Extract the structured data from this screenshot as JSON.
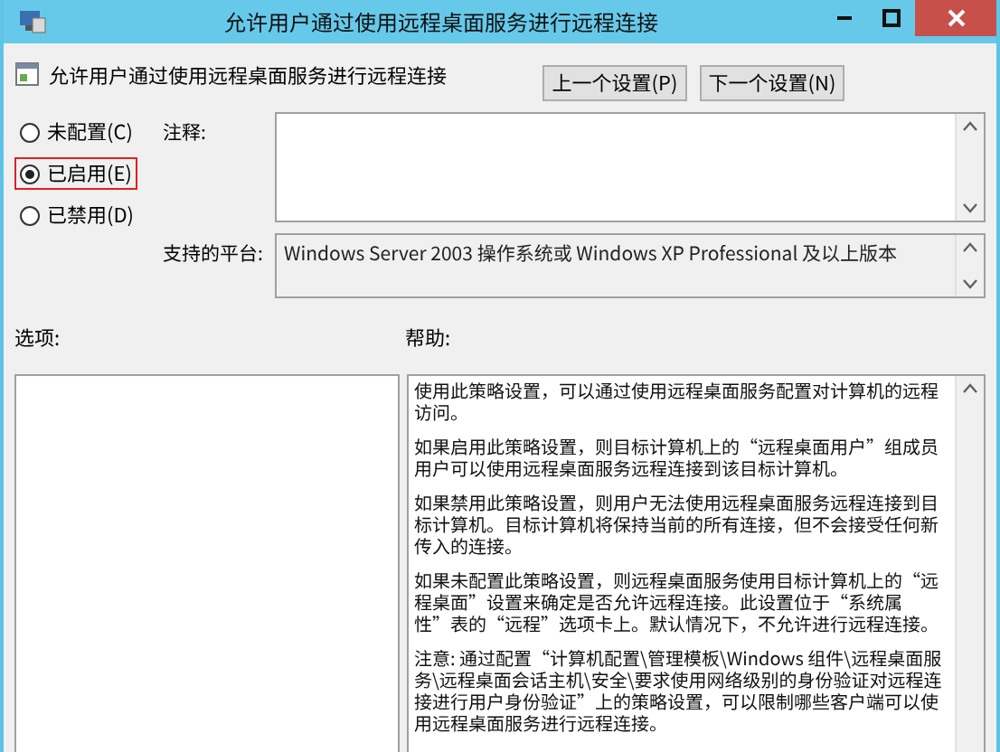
{
  "window": {
    "title": "允许用户通过使用远程桌面服务进行远程连接"
  },
  "policy": {
    "name": "允许用户通过使用远程桌面服务进行远程连接"
  },
  "nav_buttons": [
    {
      "label": "上一个设置(P)"
    },
    {
      "label": "下一个设置(N)"
    }
  ],
  "options": [
    {
      "label": "未配置(C)",
      "selected": false,
      "highlighted": false
    },
    {
      "label": "已启用(E)",
      "selected": true,
      "highlighted": true
    },
    {
      "label": "已禁用(D)",
      "selected": false,
      "highlighted": false
    }
  ],
  "comment": {
    "label": "注释:"
  },
  "platform": {
    "label": "支持的平台:",
    "value": "Windows Server 2003 操作系统或 Windows XP Professional 及以上版本"
  },
  "options_section": {
    "label": "选项:"
  },
  "help_section": {
    "label": "帮助:",
    "paragraphs": [
      "使用此策略设置，可以通过使用远程桌面服务配置对计算机的远程访问。",
      "如果启用此策略设置，则目标计算机上的“远程桌面用户”组成员用户可以使用远程桌面服务远程连接到该目标计算机。",
      "如果禁用此策略设置，则用户无法使用远程桌面服务远程连接到目标计算机。目标计算机将保持当前的所有连接，但不会接受任何新传入的连接。",
      "如果未配置此策略设置，则远程桌面服务使用目标计算机上的“远程桌面”设置来确定是否允许远程连接。此设置位于“系统属性”表的“远程”选项卡上。默认情况下，不允许进行远程连接。",
      "注意: 通过配置“计算机配置\\管理模板\\Windows 组件\\远程桌面服务\\远程桌面会话主机\\安全\\要求使用网络级别的身份验证对远程连接进行用户身份验证”上的策略设置，可以限制哪些客户端可以使用远程桌面服务进行远程连接。"
    ]
  }
}
